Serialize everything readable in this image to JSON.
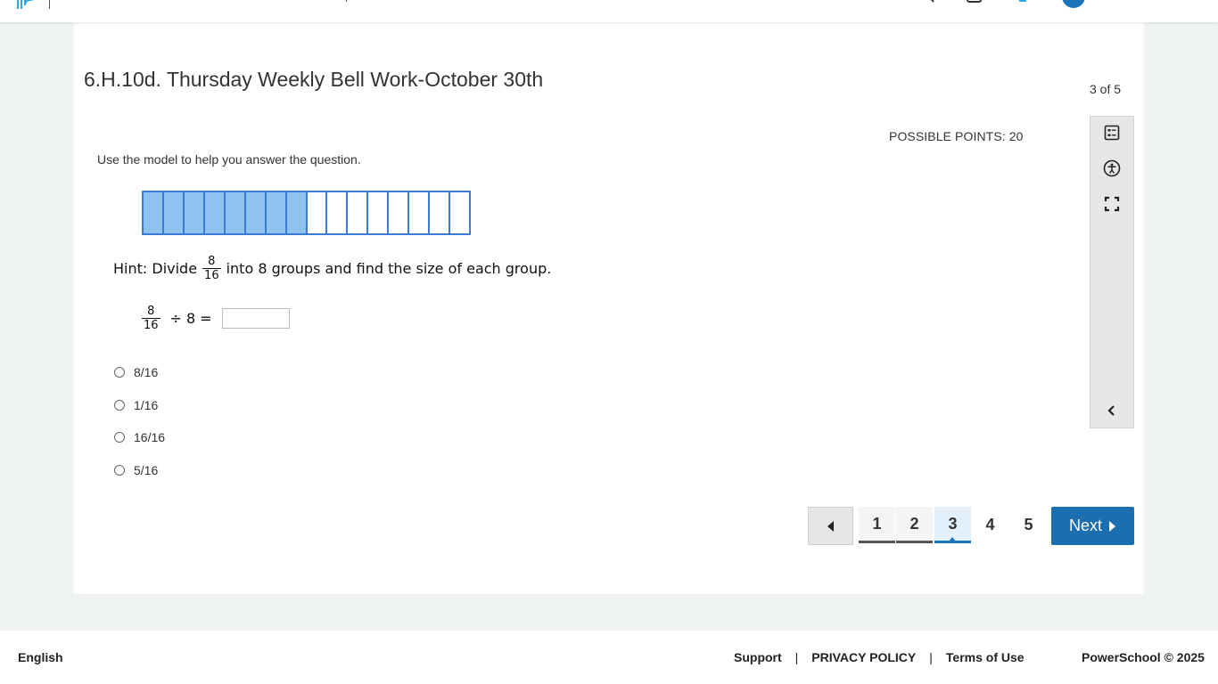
{
  "header": {
    "icons": [
      "logo-icon",
      "search-icon",
      "document-icon",
      "notification-icon",
      "avatar-icon"
    ],
    "colors": {
      "logo": "#2aa8e0",
      "avatar": "#1b75bb"
    }
  },
  "assessment": {
    "title": "6.H.10d. Thursday Weekly Bell Work-October 30th",
    "counter": "3 of 5",
    "possible_points": "POSSIBLE POINTS: 20"
  },
  "question": {
    "instruction": "Use the model to help you answer the question.",
    "model": {
      "total_parts": 16,
      "shaded_parts": 8,
      "shaded_color": "#8ec3f0",
      "border_color": "#3b7ad6"
    },
    "hint": {
      "prefix": "Hint: Divide",
      "fraction_numerator": "8",
      "fraction_denominator": "16",
      "suffix": "into 8 groups and find the size of each group."
    },
    "equation": {
      "numerator": "8",
      "denominator": "16",
      "operator": "÷",
      "divisor": "8",
      "equals": "=",
      "answer_value": ""
    },
    "choices": [
      {
        "label": "8/16",
        "selected": false
      },
      {
        "label": "1/16",
        "selected": false
      },
      {
        "label": "16/16",
        "selected": false
      },
      {
        "label": "5/16",
        "selected": false
      }
    ]
  },
  "tools": {
    "items": [
      "line-reader-icon",
      "accessibility-icon",
      "fullscreen-icon"
    ],
    "collapse": "chevron-left-icon"
  },
  "pagination": {
    "prev_icon": "triangle-left-icon",
    "pages": [
      {
        "label": "1",
        "state": "visited"
      },
      {
        "label": "2",
        "state": "visited"
      },
      {
        "label": "3",
        "state": "current"
      },
      {
        "label": "4",
        "state": "unvisited"
      },
      {
        "label": "5",
        "state": "unvisited"
      }
    ],
    "next_label": "Next",
    "next_icon": "triangle-right-icon",
    "accent_color": "#1b6fb0"
  },
  "footer": {
    "language": "English",
    "links": [
      "Support",
      "PRIVACY POLICY",
      "Terms of Use"
    ],
    "separator": "|",
    "copyright": "PowerSchool © 2025"
  }
}
